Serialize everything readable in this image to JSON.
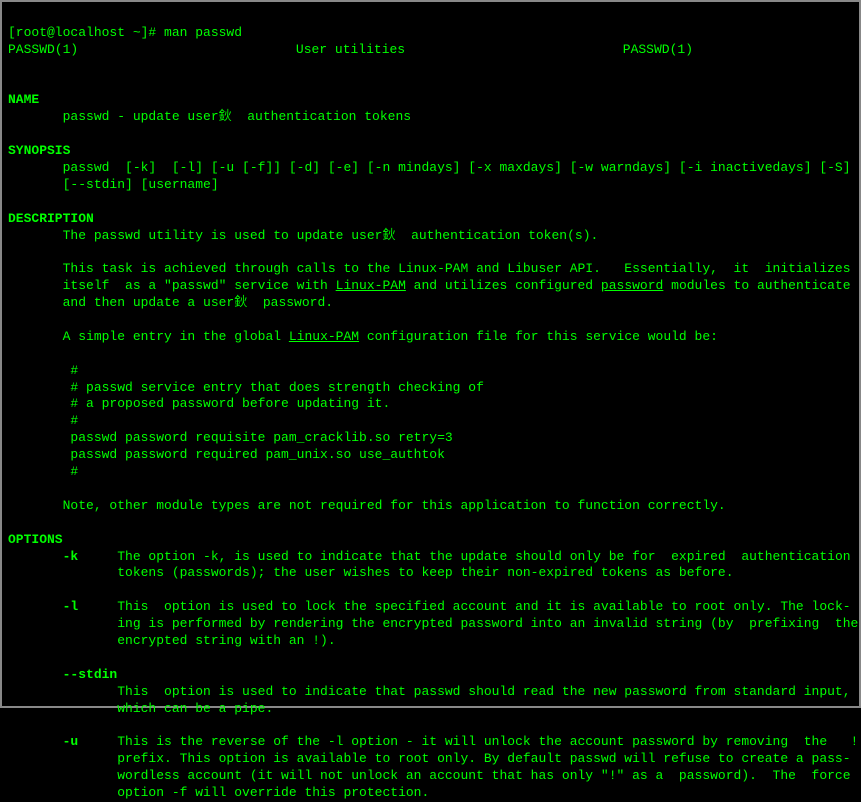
{
  "prompt": "[root@localhost ~]# man passwd",
  "header": {
    "left": "PASSWD(1)",
    "center": "User utilities",
    "right": "PASSWD(1)"
  },
  "sections": {
    "name": {
      "title": "NAME",
      "line": "       passwd - update user鈥  authentication tokens"
    },
    "synopsis": {
      "title": "SYNOPSIS",
      "line1": "       passwd  [-k]  [-l] [-u [-f]] [-d] [-e] [-n mindays] [-x maxdays] [-w warndays] [-i inactivedays] [-S]",
      "line2": "       [--stdin] [username]"
    },
    "description": {
      "title": "DESCRIPTION",
      "d1": "       The passwd utility is used to update user鈥  authentication token(s).",
      "d2a": "       This task is achieved through calls to the Linux-PAM and Libuser API.   Essentially,  it  initializes",
      "d2b_pre": "       itself  as a \"passwd\" service with ",
      "d2b_link1": "Linux-PAM",
      "d2b_mid": " and utilizes configured ",
      "d2b_link2": "password",
      "d2b_post": " modules to authenticate",
      "d2c": "       and then update a user鈥  password.",
      "d3_pre": "       A simple entry in the global ",
      "d3_link": "Linux-PAM",
      "d3_post": " configuration file for this service would be:",
      "cfg1": "        #",
      "cfg2": "        # passwd service entry that does strength checking of",
      "cfg3": "        # a proposed password before updating it.",
      "cfg4": "        #",
      "cfg5": "        passwd password requisite pam_cracklib.so retry=3",
      "cfg6": "        passwd password required pam_unix.so use_authtok",
      "cfg7": "        #",
      "note": "       Note, other module types are not required for this application to function correctly."
    },
    "options": {
      "title": "OPTIONS",
      "k_flag": "       -k",
      "k1": "     The option -k, is used to indicate that the update should only be for  expired  authentication",
      "k2": "              tokens (passwords); the user wishes to keep their non-expired tokens as before.",
      "l_flag": "       -l",
      "l1": "     This  option is used to lock the specified account and it is available to root only. The lock-",
      "l2": "              ing is performed by rendering the encrypted password into an invalid string (by  prefixing  the",
      "l3": "              encrypted string with an !).",
      "stdin_flag": "       --stdin",
      "stdin1": "              This  option is used to indicate that passwd should read the new password from standard input,",
      "stdin2": "              which can be a pipe.",
      "u_flag": "       -u",
      "u1": "     This is the reverse of the -l option - it will unlock the account password by removing  the   !",
      "u2": "              prefix. This option is available to root only. By default passwd will refuse to create a pass-",
      "u3": "              wordless account (it will not unlock an account that has only \"!\" as a  password).  The  force",
      "u4": "              option -f will override this protection."
    }
  }
}
